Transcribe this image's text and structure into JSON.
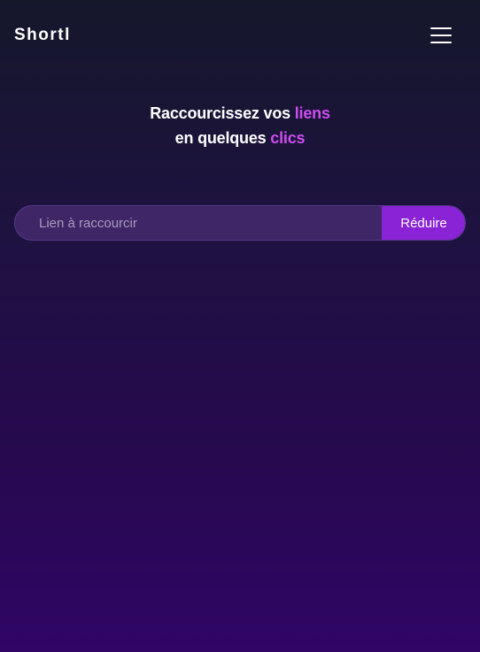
{
  "header": {
    "logo": "Shortl",
    "menu_icon": "hamburger-menu-icon"
  },
  "hero": {
    "line1_text": "Raccourcissez vos ",
    "line1_accent": "liens",
    "line2_text": "en quelques ",
    "line2_accent": "clics"
  },
  "form": {
    "input_placeholder": "Lien à raccourcir",
    "input_value": "",
    "submit_label": "Réduire"
  },
  "colors": {
    "accent": "#cc4df0",
    "button": "#8a22d6",
    "background_top": "#15172b",
    "background_bottom": "#2f0566"
  }
}
